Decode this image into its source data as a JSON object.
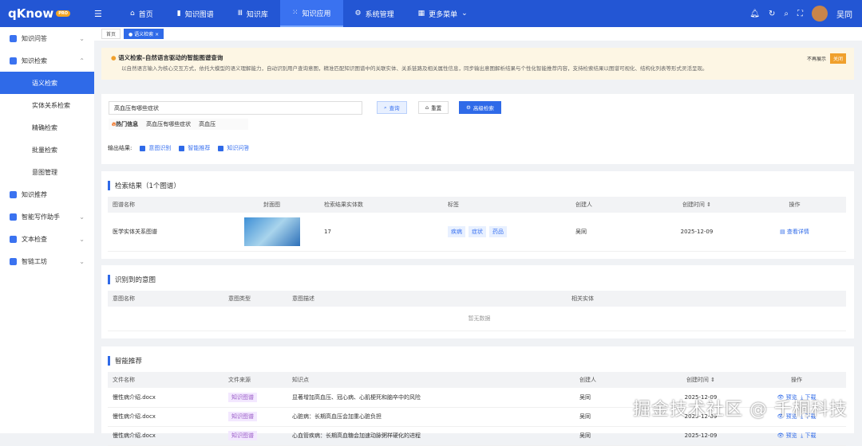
{
  "header": {
    "logo": "qKnow",
    "logo_badge": "PRO",
    "nav": [
      "首页",
      "知识图谱",
      "知识库",
      "知识应用",
      "系统管理",
      "更多菜单"
    ],
    "user": "吴同"
  },
  "sidebar": {
    "items": [
      "知识问答",
      "知识检索",
      "语义检索",
      "实体关系检索",
      "精确检索",
      "批量检索",
      "意图管理",
      "知识推荐",
      "智能写作助手",
      "文本检查",
      "智链工坊"
    ]
  },
  "tabs": [
    "首页",
    "语义检索"
  ],
  "notice": {
    "title": "语义检索–自然语言驱动的智能图谱查询",
    "desc": "以自然语言输入为核心交互方式，依托大模型的语义理解能力，自动识别用户查询意图，精准匹配知识图谱中的关联实体、关系链路及相关属性信息，同步输出意图解析结果与个性化智能推荐内容，支持检索结果以图谱可视化、结构化列表等形式灵活呈现。",
    "no_show": "不再展示",
    "close": "关闭"
  },
  "search": {
    "value": "高血压有哪些症状",
    "query": "查询",
    "reset": "重置",
    "advanced": "高级检索",
    "hot_label": "热门信息",
    "hot": [
      "高血压有哪些症状",
      "高血压"
    ],
    "output_label": "输出结果:",
    "outputs": [
      "意图识别",
      "智能推荐",
      "知识问答"
    ]
  },
  "results": {
    "title": "检索结果（1个图谱）",
    "columns": [
      "图谱名称",
      "封面图",
      "检索结果实体数",
      "标签",
      "创建人",
      "创建时间",
      "操作"
    ],
    "row": {
      "name": "医学实体关系图谱",
      "count": "17",
      "tags": [
        "疾病",
        "症状",
        "药品"
      ],
      "creator": "吴同",
      "date": "2025-12-09",
      "action": "查看详情"
    }
  },
  "intent": {
    "title": "识别到的意图",
    "columns": [
      "意图名称",
      "意图类型",
      "意图描述",
      "相关实体"
    ],
    "empty": "暂无数据"
  },
  "recommend": {
    "title": "智能推荐",
    "columns": [
      "文件名称",
      "文件来源",
      "知识点",
      "创建人",
      "创建时间",
      "操作"
    ],
    "preview": "预览",
    "download": "下载",
    "rows": [
      {
        "file": "慢性病介绍.docx",
        "source": "知识图谱",
        "point": "显著增加高血压、冠心病、心肌梗死和脑卒中的风险",
        "creator": "吴同",
        "date": "2025-12-09"
      },
      {
        "file": "慢性病介绍.docx",
        "source": "知识图谱",
        "point": "心脏病：长期高血压会加重心脏负担",
        "creator": "吴同",
        "date": "2025-12-09"
      },
      {
        "file": "慢性病介绍.docx",
        "source": "知识图谱",
        "point": "心血管疾病：长期高血糖会加速动脉粥样硬化的进程",
        "creator": "吴同",
        "date": "2025-12-09"
      }
    ]
  },
  "watermark": "掘金技术社区 @ 千桐科技"
}
